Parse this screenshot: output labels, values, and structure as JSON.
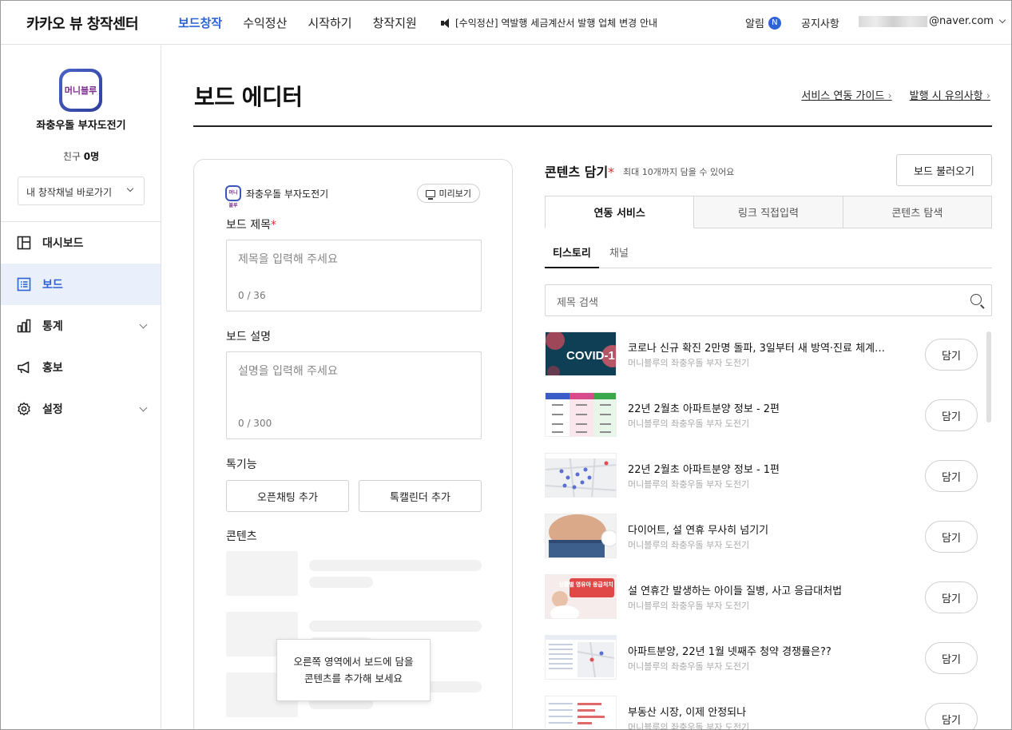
{
  "topbar": {
    "brand": "카카오 뷰 창작센터",
    "nav": [
      "보드창작",
      "수익정산",
      "시작하기",
      "창작지원"
    ],
    "notice": "[수익정산] 역발행 세금계산서 발행 업체 변경 안내",
    "alarm_label": "알림",
    "alarm_badge": "N",
    "notices_label": "공지사항",
    "account_domain": "@naver.com"
  },
  "sidebar": {
    "logo_text": "머니블루",
    "channel_name": "좌충우돌 부자도전기",
    "friends_label": "친구",
    "friends_count": "0명",
    "channel_select": "내 창작채널 바로가기",
    "menu": [
      {
        "label": "대시보드",
        "icon": "dashboard-icon"
      },
      {
        "label": "보드",
        "icon": "board-list-icon"
      },
      {
        "label": "통계",
        "icon": "stats-icon"
      },
      {
        "label": "홍보",
        "icon": "megaphone-icon"
      },
      {
        "label": "설정",
        "icon": "gear-icon"
      }
    ]
  },
  "main": {
    "title": "보드 에디터",
    "links": [
      "서비스 연동 가이드",
      "발행 시 유의사항"
    ]
  },
  "editor": {
    "channel_name": "좌충우돌 부자도전기",
    "preview": "미리보기",
    "title_label": "보드 제목",
    "title_placeholder": "제목을 입력해 주세요",
    "title_count": "0 / 36",
    "desc_label": "보드 설명",
    "desc_placeholder": "설명을 입력해 주세요",
    "desc_count": "0 / 300",
    "features_label": "톡기능",
    "open_chat_btn": "오픈채팅 추가",
    "calendar_btn": "톡캘린더 추가",
    "contents_label": "콘텐츠",
    "tooltip_line1": "오른쪽 영역에서 보드에 담을",
    "tooltip_line2": "콘텐츠를 추가해 보세요"
  },
  "panel": {
    "title": "콘텐츠 담기",
    "subtitle": "최대 10개까지 담을 수 있어요",
    "load_button": "보드 불러오기",
    "tabs": [
      "연동 서비스",
      "링크 직접입력",
      "콘텐츠 탐색"
    ],
    "subtabs": [
      "티스토리",
      "채널"
    ],
    "search_placeholder": "제목 검색",
    "add_label": "담기",
    "items": [
      {
        "title": "코로나 신규 확진 2만명 돌파, 3일부터 새 방역·진료 체계…",
        "source": "머니블루의 좌충우돌 부자 도전기",
        "thumb_text": "COVID-1"
      },
      {
        "title": "22년 2월초 아파트분양 정보 - 2편",
        "source": "머니블루의 좌충우돌 부자 도전기",
        "thumb_text": ""
      },
      {
        "title": "22년 2월초 아파트분양 정보 - 1편",
        "source": "머니블루의 좌충우돌 부자 도전기",
        "thumb_text": ""
      },
      {
        "title": "다이어트, 설 연휴 무사히 넘기기",
        "source": "머니블루의 좌충우돌 부자 도전기",
        "thumb_text": ""
      },
      {
        "title": "설 연휴간 발생하는 아이들 질병, 사고 응급대처법",
        "source": "머니블루의 좌충우돌 부자 도전기",
        "thumb_text": "상황별 영유아 응급처치 방법"
      },
      {
        "title": "아파트분양, 22년 1월 넷째주 청약 경쟁률은??",
        "source": "머니블루의 좌충우돌 부자 도전기",
        "thumb_text": ""
      },
      {
        "title": "부동산 시장, 이제 안정되나",
        "source": "머니블루의 좌충우돌 부자 도전기",
        "thumb_text": ""
      }
    ]
  },
  "colors": {
    "accent": "#2e63d8",
    "required": "#e0312b"
  }
}
